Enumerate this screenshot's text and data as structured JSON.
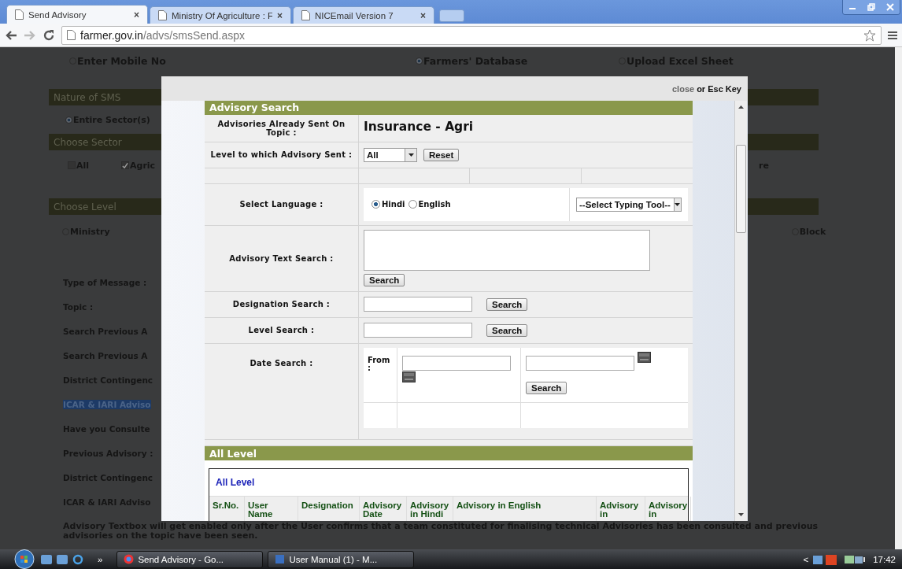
{
  "browser": {
    "tabs": [
      {
        "title": "Send Advisory",
        "close": "×",
        "selected": true
      },
      {
        "title": "Ministry Of Agriculture : F",
        "close": "×",
        "selected": false
      },
      {
        "title": "NICEmail Version 7",
        "close": "×",
        "selected": false
      }
    ],
    "url_host": "farmer.gov.in",
    "url_path": "/advs/smsSend.aspx"
  },
  "page": {
    "recipient_options": [
      {
        "label": "Enter Mobile No",
        "selected": false
      },
      {
        "label": "Farmers' Database",
        "selected": true
      },
      {
        "label": "Upload Excel Sheet",
        "selected": false
      }
    ],
    "nature_heading": "Nature of SMS",
    "nature_options": [
      {
        "label": "Entire Sector(s)",
        "selected": true
      }
    ],
    "sector_heading": "Choose Sector",
    "sector_options": [
      {
        "label": "All",
        "checked": false
      },
      {
        "label": "Agric",
        "checked": true
      }
    ],
    "sector_right_text": "re",
    "level_heading": "Choose Level",
    "level_options": [
      {
        "label": "Ministry",
        "selected": false
      },
      {
        "label": "Block",
        "selected": false
      }
    ],
    "form_labels": [
      {
        "text": "Type of Message :",
        "highlighted": false
      },
      {
        "text": "Topic :",
        "highlighted": false
      },
      {
        "text": "Search Previous A",
        "highlighted": false
      },
      {
        "text": "Search Previous A",
        "highlighted": false
      },
      {
        "text": "District Contingenc",
        "highlighted": false
      },
      {
        "text": "ICAR & IARI Adviso",
        "highlighted": true
      },
      {
        "text": "Have you Consulte",
        "highlighted": false
      },
      {
        "text": "Previous Advisory :",
        "highlighted": false
      },
      {
        "text": "District Contingenc",
        "highlighted": false
      },
      {
        "text": "ICAR & IARI Adviso",
        "highlighted": false
      }
    ],
    "note_lines": [
      "Advisory Textbox will get enabled only after the User confirms that a team constituted for finalising technical Advisories has been consulted and previous",
      "advisories on the topic have been seen."
    ]
  },
  "modal": {
    "close_link": "close",
    "close_hint": "or Esc Key",
    "advisory_search": {
      "heading": "Advisory Search",
      "topic_label": "Advisories Already Sent On Topic :",
      "topic_value": "Insurance - Agri",
      "level_label": "Level to which Advisory Sent :",
      "level_select": "All",
      "reset_button": "Reset",
      "language_label": "Select Language :",
      "languages": [
        {
          "label": "Hindi",
          "selected": true
        },
        {
          "label": "English",
          "selected": false
        }
      ],
      "typing_tool_select": "--Select Typing Tool--",
      "text_search_label": "Advisory Text Search :",
      "text_search_button": "Search",
      "designation_label": "Designation Search :",
      "designation_button": "Search",
      "level_search_label": "Level Search :",
      "level_search_button": "Search",
      "date_label": "Date Search :",
      "date_from_label": "From :",
      "date_button": "Search"
    },
    "all_level": {
      "heading": "All Level",
      "table_title": "All Level",
      "columns": [
        "Sr.No.",
        "User Name",
        "Designation",
        "Advisory Date",
        "Advisory in Hindi",
        "Advisory in English",
        "Advisory in",
        "Advisory in"
      ]
    }
  },
  "taskbar": {
    "overflow": "»",
    "tray_expand": "<",
    "tasks": [
      "Send Advisory - Go...",
      "User Manual (1) - M..."
    ],
    "clock": "17:42"
  }
}
